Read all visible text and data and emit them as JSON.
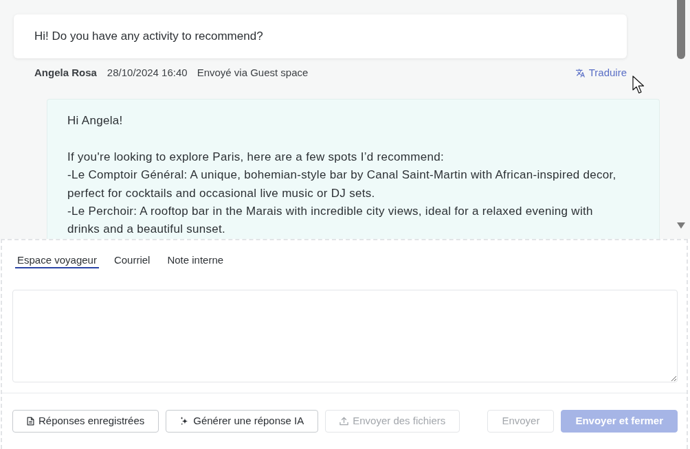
{
  "conversation": {
    "guest_message": {
      "text": "Hi! Do you have any activity to recommend?",
      "author": "Angela Rosa",
      "timestamp": "28/10/2024 16:40",
      "channel": "Envoyé via Guest space",
      "translate_link": "Traduire"
    },
    "reply": {
      "blocks": [
        {
          "lines": [
            "Hi Angela!"
          ]
        },
        {
          "lines": [
            "If you're looking to explore Paris, here are a few spots I’d recommend:",
            "-Le Comptoir Général: A unique, bohemian-style bar by Canal Saint-Martin with African-inspired decor, perfect for cocktails and occasional live music or DJ sets.",
            "-Le Perchoir: A rooftop bar in the Marais with incredible city views, ideal for a relaxed evening with drinks and a beautiful sunset."
          ]
        }
      ]
    }
  },
  "composer": {
    "tabs": [
      {
        "label": "Espace voyageur",
        "selected": true
      },
      {
        "label": "Courriel",
        "selected": false
      },
      {
        "label": "Note interne",
        "selected": false
      }
    ],
    "buttons": [
      {
        "label": "Réponses enregistrées",
        "kind": "saved-replies",
        "disabled": false
      },
      {
        "label": "Générer une réponse IA",
        "kind": "ai-generate",
        "disabled": false
      },
      {
        "label": "Envoyer des fichiers",
        "kind": "upload",
        "disabled": true
      },
      {
        "label": "Envoyer",
        "kind": "send",
        "disabled": true
      },
      {
        "label": "Envoyer et fermer",
        "kind": "send-close",
        "disabled": true
      }
    ]
  }
}
